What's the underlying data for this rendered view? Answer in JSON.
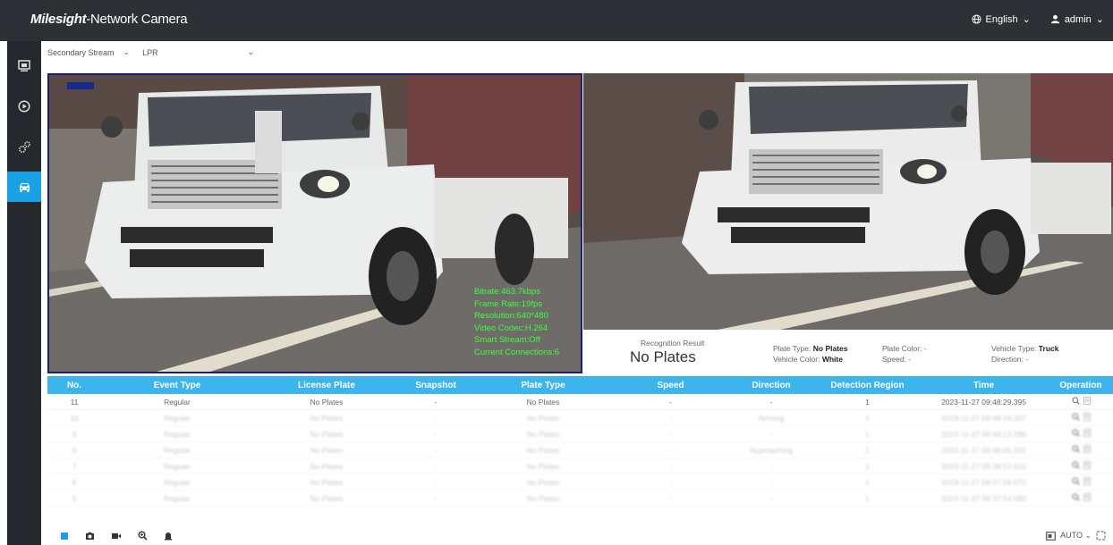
{
  "header": {
    "brand_italic": "Milesight",
    "brand_rest": "-Network Camera",
    "language": "English",
    "user": "admin"
  },
  "sidebar": {
    "items": [
      {
        "name": "live-view",
        "icon": "monitor-icon",
        "active": false
      },
      {
        "name": "playback",
        "icon": "play-circle-icon",
        "active": false
      },
      {
        "name": "settings",
        "icon": "gears-icon",
        "active": false
      },
      {
        "name": "vehicle",
        "icon": "car-icon",
        "active": true
      }
    ]
  },
  "toolbar": {
    "stream": "Secondary Stream",
    "mode": "LPR"
  },
  "osd": {
    "bitrate": "Bitrate:463.7kbps",
    "frame_rate": "Frame Rate:19fps",
    "resolution": "Resolution:640*480",
    "codec": "Video Codec:H.264",
    "smart_stream": "Smart Stream:Off",
    "connections": "Current Connections:6"
  },
  "result": {
    "title": "Recognition Result",
    "value": "No Plates",
    "plate_type_label": "Plate Type:",
    "plate_type": "No Plates",
    "vehicle_color_label": "Vehicle Color:",
    "vehicle_color": "White",
    "plate_color_label": "Plate Color:",
    "plate_color": "-",
    "speed_label": "Speed:",
    "speed": "-",
    "vehicle_type_label": "Vehicle Type:",
    "vehicle_type": "Truck",
    "direction_label": "Direction:",
    "direction": "-"
  },
  "table": {
    "headers": [
      "No.",
      "Event Type",
      "License Plate",
      "Snapshot",
      "Plate Type",
      "Speed",
      "Direction",
      "Detection Region",
      "Time",
      "Operation"
    ],
    "rows": [
      [
        "11",
        "Regular",
        "No Plates",
        "-",
        "No Plates",
        "-",
        "-",
        "1",
        "2023-11-27 09:48:29.395"
      ],
      [
        "10",
        "Regular",
        "No Plates",
        "-",
        "No Plates",
        "-",
        "Arriving",
        "1",
        "2023-11-27 09:48:24.207"
      ],
      [
        "9",
        "Regular",
        "No Plates",
        "-",
        "No Plates",
        "-",
        "-",
        "1",
        "2023-11-27 09:48:13.286"
      ],
      [
        "8",
        "Regular",
        "No Plates",
        "-",
        "No Plates",
        "-",
        "Approaching",
        "1",
        "2023-11-27 09:48:05.332"
      ],
      [
        "7",
        "Regular",
        "No Plates",
        "-",
        "No Plates",
        "-",
        "-",
        "1",
        "2023-11-27 09:38:53.610"
      ],
      [
        "6",
        "Regular",
        "No Plates",
        "-",
        "No Plates",
        "-",
        "-",
        "1",
        "2023-11-27 09:37:58.072"
      ],
      [
        "5",
        "Regular",
        "No Plates",
        "-",
        "No Plates",
        "-",
        "-",
        "1",
        "2023-11-27 09:37:54.090"
      ]
    ]
  },
  "bottom": {
    "auto": "AUTO"
  },
  "colors": {
    "accent": "#1aa0e5",
    "header_bg": "#2d3035",
    "table_header": "#3cb4ec",
    "osd": "#3cff3c"
  }
}
